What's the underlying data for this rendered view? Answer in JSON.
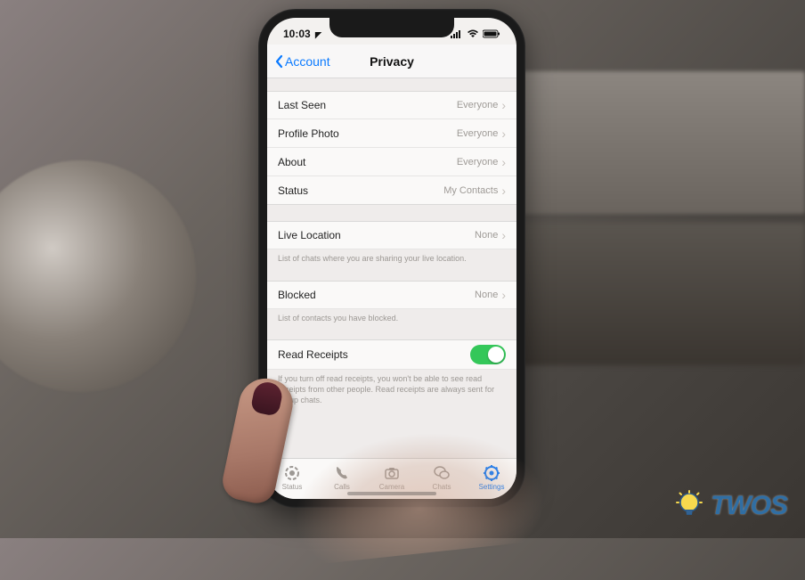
{
  "status_bar": {
    "time": "10:03",
    "location_icon": "location-arrow"
  },
  "nav": {
    "back_label": "Account",
    "title": "Privacy"
  },
  "sections": [
    {
      "rows": [
        {
          "label": "Last Seen",
          "value": "Everyone"
        },
        {
          "label": "Profile Photo",
          "value": "Everyone"
        },
        {
          "label": "About",
          "value": "Everyone"
        },
        {
          "label": "Status",
          "value": "My Contacts"
        }
      ]
    },
    {
      "rows": [
        {
          "label": "Live Location",
          "value": "None"
        }
      ],
      "footer": "List of chats where you are sharing your live location."
    },
    {
      "rows": [
        {
          "label": "Blocked",
          "value": "None"
        }
      ],
      "footer": "List of contacts you have blocked."
    },
    {
      "toggle_label": "Read Receipts",
      "toggle_on": true,
      "footer": "If you turn off read receipts, you won't be able to see read receipts from other people. Read receipts are always sent for group chats."
    }
  ],
  "tabs": [
    {
      "label": "Status",
      "icon": "status-ring",
      "active": false
    },
    {
      "label": "Calls",
      "icon": "phone",
      "active": false
    },
    {
      "label": "Camera",
      "icon": "camera",
      "active": false
    },
    {
      "label": "Chats",
      "icon": "chat-bubbles",
      "active": false
    },
    {
      "label": "Settings",
      "icon": "gear",
      "active": true
    }
  ],
  "watermark": {
    "text": "TWOS"
  }
}
